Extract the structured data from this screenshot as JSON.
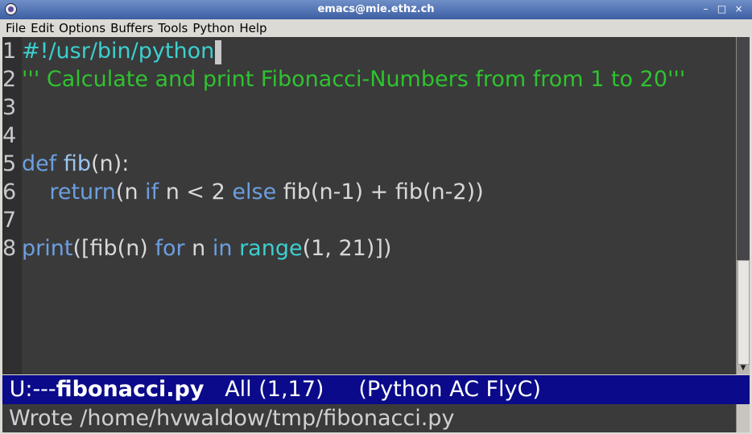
{
  "window": {
    "title": "emacs@mie.ethz.ch",
    "minimize": "–",
    "maximize": "□",
    "close": "×"
  },
  "menu": [
    "File",
    "Edit",
    "Options",
    "Buffers",
    "Tools",
    "Python",
    "Help"
  ],
  "lines": [
    {
      "num": "1",
      "tokens": [
        {
          "t": "#!/usr/bin/python",
          "c": "bi"
        }
      ],
      "cursor": true
    },
    {
      "num": "2",
      "tokens": [
        {
          "t": "''' Calculate and print Fibonacci-Numbers from from 1 to 20'''",
          "c": "str"
        }
      ]
    },
    {
      "num": "3",
      "tokens": []
    },
    {
      "num": "4",
      "tokens": []
    },
    {
      "num": "5",
      "tokens": [
        {
          "t": "def",
          "c": "kw"
        },
        {
          "t": " ",
          "c": ""
        },
        {
          "t": "fib",
          "c": "fn"
        },
        {
          "t": "(n):",
          "c": ""
        }
      ]
    },
    {
      "num": "6",
      "tokens": [
        {
          "t": "    ",
          "c": ""
        },
        {
          "t": "return",
          "c": "kw"
        },
        {
          "t": "(n ",
          "c": ""
        },
        {
          "t": "if",
          "c": "kw"
        },
        {
          "t": " n < 2 ",
          "c": ""
        },
        {
          "t": "else",
          "c": "kw"
        },
        {
          "t": " fib(n-1) + fib(n-2))",
          "c": ""
        }
      ]
    },
    {
      "num": "7",
      "tokens": []
    },
    {
      "num": "8",
      "tokens": [
        {
          "t": "print",
          "c": "kw"
        },
        {
          "t": "([fib(n) ",
          "c": ""
        },
        {
          "t": "for",
          "c": "kw"
        },
        {
          "t": " n ",
          "c": ""
        },
        {
          "t": "in",
          "c": "kw"
        },
        {
          "t": " ",
          "c": ""
        },
        {
          "t": "range",
          "c": "bi"
        },
        {
          "t": "(1, 21)])",
          "c": ""
        }
      ]
    }
  ],
  "modeline": {
    "status": " U:---",
    "buffer": "fibonacci.py",
    "position": "   All (1,17)",
    "modes": "     (Python AC FlyC)"
  },
  "echo": "Wrote /home/hvwaldow/tmp/fibonacci.py",
  "colors": {
    "background": "#3a3a3a",
    "modeline": "#0a0a8a",
    "string": "#2fc32f",
    "keyword": "#6c9fe0",
    "builtin": "#3dcfcf"
  }
}
